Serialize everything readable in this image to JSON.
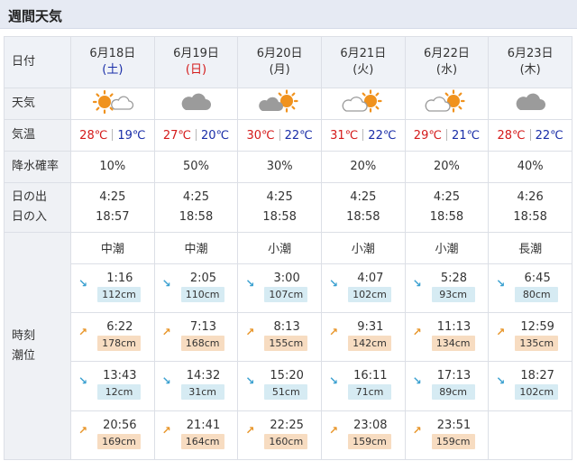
{
  "header": {
    "title": "週間天気"
  },
  "labels": {
    "date": "日付",
    "weather": "天気",
    "temp": "気温",
    "rain": "降水確率",
    "sunrise": "日の出",
    "sunset": "日の入",
    "tide_time": "時刻",
    "tide_level": "潮位"
  },
  "days": [
    {
      "date": "6月18日",
      "dow": "(土)",
      "dow_type": "sat",
      "weather_icon": "sun-cloud-icon",
      "high": "28℃",
      "low": "19℃",
      "rain": "10%",
      "sunrise": "4:25",
      "sunset": "18:57",
      "tide_type": "中潮",
      "tides": [
        {
          "time": "1:16",
          "level": "112cm",
          "dir": "down"
        },
        {
          "time": "6:22",
          "level": "178cm",
          "dir": "up"
        },
        {
          "time": "13:43",
          "level": "12cm",
          "dir": "down"
        },
        {
          "time": "20:56",
          "level": "169cm",
          "dir": "up"
        }
      ]
    },
    {
      "date": "6月19日",
      "dow": "(日)",
      "dow_type": "sun",
      "weather_icon": "cloud-icon",
      "high": "27℃",
      "low": "20℃",
      "rain": "50%",
      "sunrise": "4:25",
      "sunset": "18:58",
      "tide_type": "中潮",
      "tides": [
        {
          "time": "2:05",
          "level": "110cm",
          "dir": "down"
        },
        {
          "time": "7:13",
          "level": "168cm",
          "dir": "up"
        },
        {
          "time": "14:32",
          "level": "31cm",
          "dir": "down"
        },
        {
          "time": "21:41",
          "level": "164cm",
          "dir": "up"
        }
      ]
    },
    {
      "date": "6月20日",
      "dow": "(月)",
      "dow_type": "weekday",
      "weather_icon": "cloud-sun-icon",
      "high": "30℃",
      "low": "22℃",
      "rain": "30%",
      "sunrise": "4:25",
      "sunset": "18:58",
      "tide_type": "小潮",
      "tides": [
        {
          "time": "3:00",
          "level": "107cm",
          "dir": "down"
        },
        {
          "time": "8:13",
          "level": "155cm",
          "dir": "up"
        },
        {
          "time": "15:20",
          "level": "51cm",
          "dir": "down"
        },
        {
          "time": "22:25",
          "level": "160cm",
          "dir": "up"
        }
      ]
    },
    {
      "date": "6月21日",
      "dow": "(火)",
      "dow_type": "weekday",
      "weather_icon": "cloud-sun-light-icon",
      "high": "31℃",
      "low": "22℃",
      "rain": "20%",
      "sunrise": "4:25",
      "sunset": "18:58",
      "tide_type": "小潮",
      "tides": [
        {
          "time": "4:07",
          "level": "102cm",
          "dir": "down"
        },
        {
          "time": "9:31",
          "level": "142cm",
          "dir": "up"
        },
        {
          "time": "16:11",
          "level": "71cm",
          "dir": "down"
        },
        {
          "time": "23:08",
          "level": "159cm",
          "dir": "up"
        }
      ]
    },
    {
      "date": "6月22日",
      "dow": "(水)",
      "dow_type": "weekday",
      "weather_icon": "cloud-sun-light-icon",
      "high": "29℃",
      "low": "21℃",
      "rain": "20%",
      "sunrise": "4:25",
      "sunset": "18:58",
      "tide_type": "小潮",
      "tides": [
        {
          "time": "5:28",
          "level": "93cm",
          "dir": "down"
        },
        {
          "time": "11:13",
          "level": "134cm",
          "dir": "up"
        },
        {
          "time": "17:13",
          "level": "89cm",
          "dir": "down"
        },
        {
          "time": "23:51",
          "level": "159cm",
          "dir": "up"
        }
      ]
    },
    {
      "date": "6月23日",
      "dow": "(木)",
      "dow_type": "weekday",
      "weather_icon": "cloud-icon",
      "high": "28℃",
      "low": "22℃",
      "rain": "40%",
      "sunrise": "4:26",
      "sunset": "18:58",
      "tide_type": "長潮",
      "tides": [
        {
          "time": "6:45",
          "level": "80cm",
          "dir": "down"
        },
        {
          "time": "12:59",
          "level": "135cm",
          "dir": "up"
        },
        {
          "time": "18:27",
          "level": "102cm",
          "dir": "down"
        }
      ]
    }
  ],
  "colors": {
    "high_temp": "#d41a1a",
    "low_temp": "#1a2ea8",
    "tide_down_arrow": "#3aa0d0",
    "tide_up_arrow": "#e8962a",
    "low_badge": "#d6ebf3",
    "high_badge": "#f7dcc1"
  }
}
